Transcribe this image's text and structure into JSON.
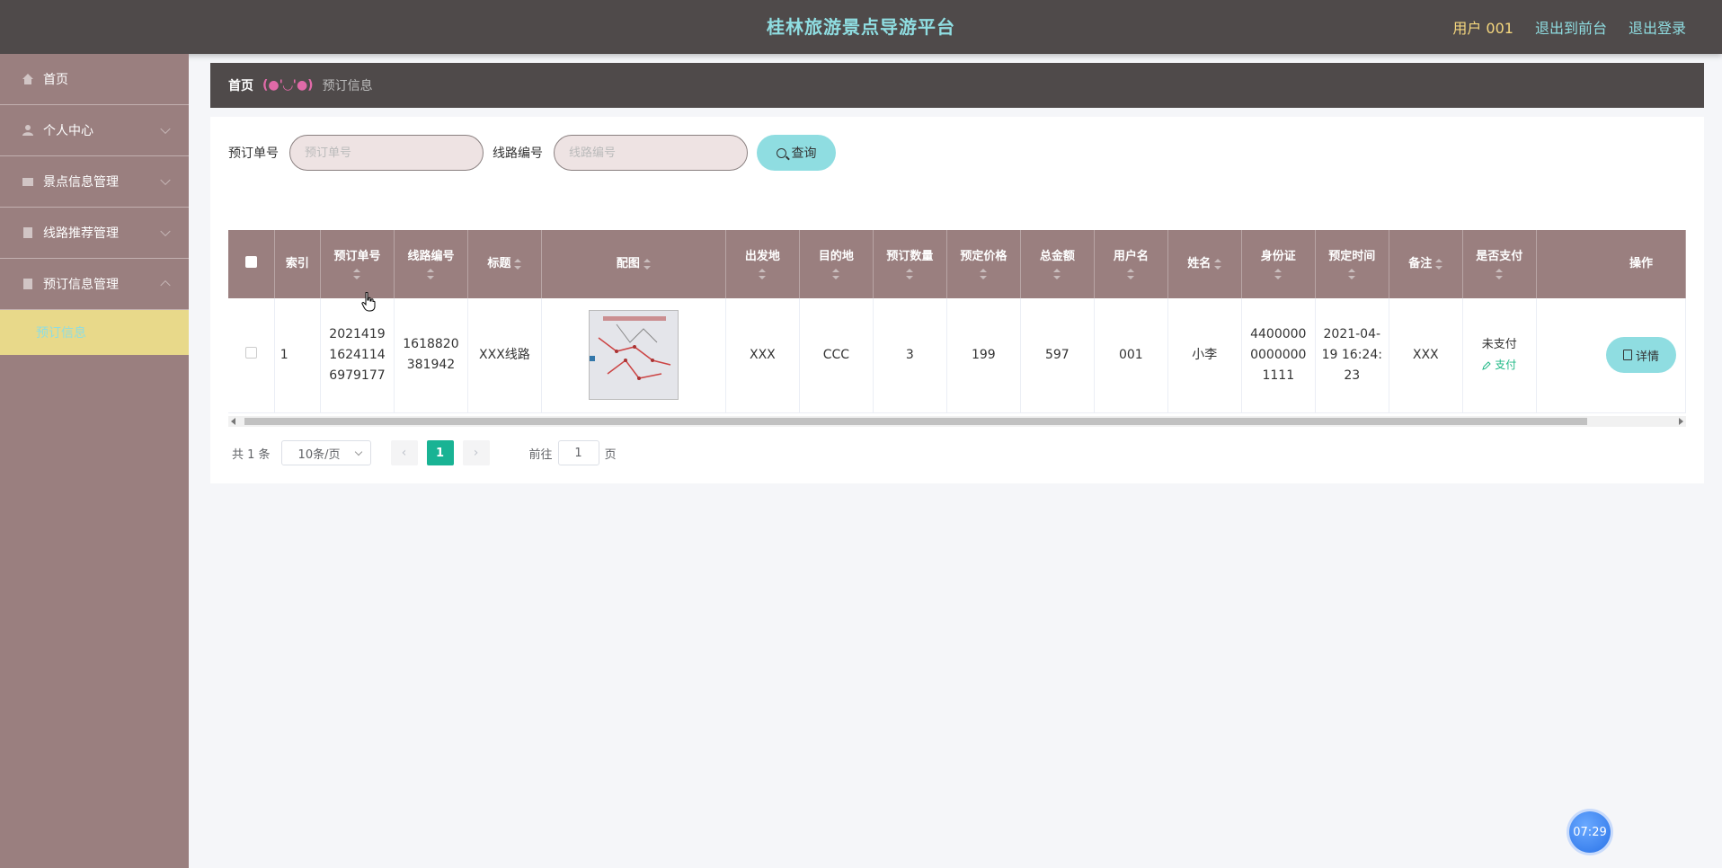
{
  "header": {
    "title": "桂林旅游景点导游平台",
    "user_label": "用户 001",
    "to_front_label": "退出到前台",
    "logout_label": "退出登录"
  },
  "sidebar": {
    "items": [
      {
        "label": "首页",
        "icon": "home-icon"
      },
      {
        "label": "个人中心",
        "icon": "user-icon"
      },
      {
        "label": "景点信息管理",
        "icon": "scenic-icon"
      },
      {
        "label": "线路推荐管理",
        "icon": "route-icon"
      },
      {
        "label": "预订信息管理",
        "icon": "booking-icon"
      }
    ],
    "active_sub": "预订信息"
  },
  "breadcrumb": {
    "home": "首页",
    "sep": "(●'◡'●)",
    "current": "预订信息"
  },
  "search": {
    "order_label": "预订单号",
    "order_placeholder": "预订单号",
    "route_label": "线路编号",
    "route_placeholder": "线路编号",
    "query_label": "查询"
  },
  "table": {
    "headers": [
      "索引",
      "预订单号",
      "线路编号",
      "标题",
      "配图",
      "出发地",
      "目的地",
      "预订数量",
      "预定价格",
      "总金额",
      "用户名",
      "姓名",
      "身份证",
      "预定时间",
      "备注",
      "是否支付",
      "操作"
    ],
    "rows": [
      {
        "index": "1",
        "order_no": "20214191624114 6979177",
        "route_no": "1618820381942",
        "title": "XXX线路",
        "depart": "XXX",
        "dest": "CCC",
        "qty": "3",
        "price": "199",
        "total": "597",
        "username": "001",
        "name": "小李",
        "id_card": "440000000000001111",
        "time": "2021-04-19 16:24:23",
        "remark": "XXX",
        "paid": "未支付",
        "pay_action": "支付",
        "detail_label": "详情"
      }
    ]
  },
  "pager": {
    "total": "共 1 条",
    "page_size": "10条/页",
    "current_page": "1",
    "goto_label": "前往",
    "goto_value": "1",
    "page_suffix": "页"
  },
  "clock": "07:29",
  "colors": {
    "topbar": "#4f4a4a",
    "sidebar": "#9a7f7f",
    "accent": "#8fdde1",
    "active_sub_bg": "#e8d98a",
    "pager_active": "#19b394"
  }
}
